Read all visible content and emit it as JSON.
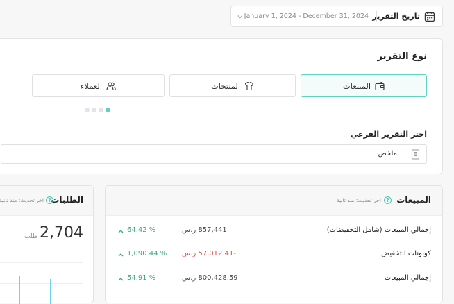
{
  "date_filter": {
    "label": "تاريخ التقرير",
    "range": "January 1, 2024 - December 31, 2024"
  },
  "report_type": {
    "title": "نوع التقرير",
    "tabs": [
      {
        "label": "المبيعات",
        "icon": "wallet-icon",
        "active": true
      },
      {
        "label": "المنتجات",
        "icon": "shirt-icon",
        "active": false
      },
      {
        "label": "العملاء",
        "icon": "users-icon",
        "active": false
      }
    ],
    "subreport_label": "اختر التقرير الفرعي",
    "subreport_value": "ملخص"
  },
  "sales": {
    "title": "المبيعات",
    "updated": "اخر تحديث: منذ ثانية",
    "rows": [
      {
        "label": "إجمالي المبيعات (شامل التخفيضات)",
        "value": "857,441 ر.س",
        "change": "64.42 %"
      },
      {
        "label": "كوبونات التخفيض",
        "value": "-57,012.41 ر.س",
        "change": "1,090.44 %"
      },
      {
        "label": "إجمالي المبيعات",
        "value": "800,428.59 ر.س",
        "change": "54.91 %"
      }
    ]
  },
  "orders": {
    "title": "الطلبات",
    "updated": "اخر تحديث: منذ ثانية",
    "count": "2,704",
    "unit": "طلب"
  },
  "colors": {
    "accent": "#5fd3be",
    "positive": "#3aa67b",
    "negative": "#e0483e",
    "chart": "#6fd3e9"
  }
}
